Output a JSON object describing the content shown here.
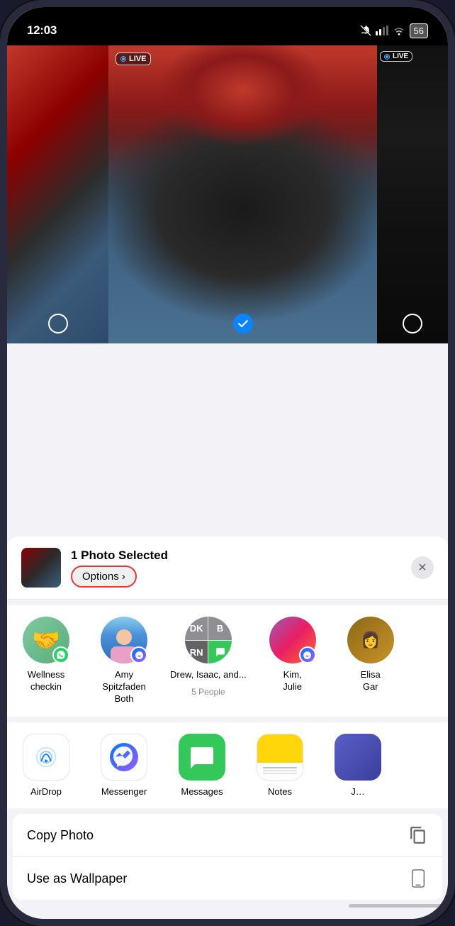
{
  "statusBar": {
    "time": "12:03",
    "battery": "56"
  },
  "shareHeader": {
    "title": "1 Photo Selected",
    "optionsLabel": "Options",
    "optionsChevron": "›",
    "closeLabel": "✕"
  },
  "contacts": [
    {
      "name": "Wellness\ncheckin",
      "type": "wellness",
      "badge": "whatsapp"
    },
    {
      "name": "Amy\nSpitzfaden\nBoth",
      "type": "amy",
      "badge": "messenger"
    },
    {
      "name": "Drew, Isaac, and...\n5 People",
      "type": "group",
      "badge": "messages"
    },
    {
      "name": "Kim,\nJulie",
      "type": "kim",
      "badge": "messenger"
    },
    {
      "name": "Elisa\nGar",
      "type": "elisa",
      "badge": null
    }
  ],
  "apps": [
    {
      "name": "AirDrop",
      "type": "airdrop"
    },
    {
      "name": "Messenger",
      "type": "messenger"
    },
    {
      "name": "Messages",
      "type": "messages"
    },
    {
      "name": "Notes",
      "type": "notes"
    },
    {
      "name": "J…",
      "type": "fifth"
    }
  ],
  "actions": [
    {
      "label": "Copy Photo",
      "icon": "copy"
    },
    {
      "label": "Use as Wallpaper",
      "icon": "phone"
    }
  ],
  "photos": {
    "leftLive": false,
    "centerLive": true,
    "rightLive": true,
    "centerSelected": true,
    "liveLabel": "LIVE"
  }
}
